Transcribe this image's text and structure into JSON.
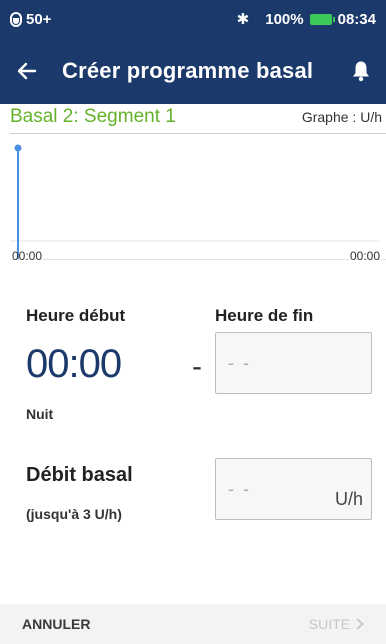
{
  "status_bar": {
    "pod_label": "50+",
    "battery_percent": "100%",
    "time": "08:34",
    "bluetooth_icon": "bluetooth-icon",
    "battery_color": "#3cc85a"
  },
  "app_bar": {
    "title": "Créer programme basal",
    "back_icon": "arrow-left-icon",
    "notification_icon": "bell-icon",
    "background_color": "#1b3a6b"
  },
  "graph": {
    "segment_title": "Basal 2: Segment 1",
    "unit_label": "Graphe : U/h",
    "x_start_label": "00:00",
    "x_end_label": "00:00",
    "segment_color": "#64b22c",
    "line_color": "#4a90e2"
  },
  "form": {
    "start_time_label": "Heure début",
    "start_time_value": "00:00",
    "start_period": "Nuit",
    "dash": "-",
    "end_time_label": "Heure de fin",
    "end_time_placeholder": "- -",
    "basal_rate_label": "Débit basal",
    "basal_rate_hint": "(jusqu'à 3 U/h)",
    "basal_rate_placeholder": "- -",
    "basal_rate_unit": "U/h"
  },
  "footer": {
    "cancel_label": "ANNULER",
    "next_label": "SUITE",
    "next_icon": "chevron-right-icon"
  }
}
